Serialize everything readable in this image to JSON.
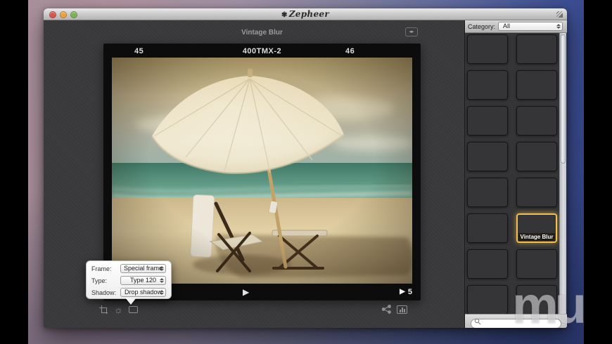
{
  "window": {
    "title": "Zepheer",
    "logo_glyph": "✾",
    "traffic_lights": {
      "close": "#d9544c",
      "minimize": "#e8a33d",
      "zoom": "#7ab356"
    }
  },
  "canvas": {
    "filter_title": "Vintage Blur",
    "expand_glyph": "◂▸",
    "film": {
      "left_number": "45",
      "center_label": "400TMX-2",
      "right_number": "46",
      "play_glyph": "▶",
      "counter_play_glyph": "▶",
      "counter": "5"
    },
    "toolbar": {
      "sun_glyph": "☼"
    }
  },
  "popover": {
    "rows": [
      {
        "label": "Frame:",
        "value": "Special frame"
      },
      {
        "label": "Type:",
        "value": "Type 120"
      },
      {
        "label": "Shadow:",
        "value": "Drop shadow"
      }
    ]
  },
  "sidebar": {
    "category": {
      "label": "Category:",
      "value": "All"
    },
    "selected_thumb_label": "Vintage Blur",
    "accent_gold": "#f0be52",
    "thumbs": [
      {
        "style": "background-image:radial-gradient(ellipse 44% 30% at 47% 24%, #f8f4ed 0 58%, rgba(0,0,0,0) 63%),radial-gradient(ellipse 32% 17% at 49% 73%, rgba(128,44,36,.92) 0 55%, rgba(0,0,0,0) 63%),linear-gradient(180deg,#eedad6 0%,#e6cdd2 36%,#b4c0da 42%,#a9b6d2 54%,#e8d5cb 60%,#e0c5ba 100%);"
      },
      {
        "style": "background-image:radial-gradient(ellipse 44% 30% at 47% 24%, #f4f9f3 0 58%, rgba(0,0,0,0) 63%),radial-gradient(ellipse 32% 17% at 49% 73%, rgba(18,74,62,.95) 0 55%, rgba(0,0,0,0) 63%),linear-gradient(180deg,#8cc8de 0%,#54aac8 36%,#2f9488 44%,#3aa896 56%,#a6c8ae 64%,#8cb898 100%);box-shadow:inset 5px 0 0 #e9dfbc, inset -5px 0 0 #e9dfbc, 0 1px 3px rgba(0,0,0,.5);"
      },
      {
        "style": "background-image:radial-gradient(ellipse 44% 30% at 47% 24%, #f0e8cf 0 58%, rgba(0,0,0,0) 63%),radial-gradient(ellipse 32% 17% at 49% 73%, rgba(74,52,26,.95) 0 55%, rgba(0,0,0,0) 63%),linear-gradient(180deg,#d8c9a2 0%,#cdbb90 36%,#b6a87e 44%,#b0a276 56%,#ccb88c 62%,#c2ad7e 100%);box-shadow:inset 6px 0 0 #7c5c32, inset -6px 0 0 #6e5028, 0 1px 3px rgba(0,0,0,.5);"
      },
      {
        "style": "background-image:radial-gradient(ellipse at 50% 48%, rgba(0,0,0,0) 38%, rgba(18,12,4,.78) 100%),radial-gradient(ellipse 44% 30% at 47% 24%, #ddd2b2 0 58%, rgba(0,0,0,0) 63%),radial-gradient(ellipse 32% 17% at 49% 73%, rgba(40,28,16,.95) 0 55%, rgba(0,0,0,0) 63%),linear-gradient(180deg,#a09274 0%,#958862 36%,#8a8060 44%,#837a56 56%,#8f8260 62%,#7e7048 100%);"
      },
      {
        "style": "background-image:radial-gradient(ellipse 40% 26% at 47% 28%, #f3ecd4 0 58%, rgba(0,0,0,0) 63%),radial-gradient(ellipse 30% 15% at 49% 70%, rgba(90,66,36,.8) 0 55%, rgba(0,0,0,0) 63%),linear-gradient(180deg,#e0d3ac 0%,#d8cba6 50%,#cfc096 100%);box-shadow:inset 0 0 0 5px #efe6c9, 0 1px 3px rgba(0,0,0,.5);"
      },
      {
        "style": "background-color:#160505;background-image:repeating-linear-gradient(112deg, rgba(225,45,55,.9) 0 1px, rgba(0,0,0,0) 1px 6px),repeating-linear-gradient(28deg, rgba(180,30,60,.55) 0 1px, rgba(0,0,0,0) 1px 8px),radial-gradient(ellipse at 55% 45%, rgba(120,10,20,.6) 0 45%, rgba(0,0,0,0) 62%);"
      },
      {
        "style": "background-color:#16160f;background-image:radial-gradient(ellipse 30% 16% at 49% 66%, rgba(60,58,38,.9) 0 55%, rgba(0,0,0,0) 63%),radial-gradient(ellipse 46% 42% at 50% 50%, #c2dcb2 0 48%, #8fae85 62%, #2a2a1e 92%);"
      },
      {
        "style": "background-color:#969696;background-repeat:no-repeat;background-image:radial-gradient(circle, #2e2e2e 0 40%, rgba(0,0,0,0) 46%),radial-gradient(circle, #2e2e2e 0 40%, rgba(0,0,0,0) 46%),linear-gradient(180deg,#e8f2f4 0 35%,#8ec4d0 35% 55%,#d8cba6 55% 100%),linear-gradient(#6b4a2e,#6b4a2e),linear-gradient(#8a8a8a,#7c7c7c);background-size:7px 7px,7px 7px,34px 24px,42px 32px,58px 42px;background-position:46px 4px,46px 13px,5px 6px,1px 2px,0 0;"
      },
      {
        "style": "background-image:radial-gradient(ellipse 44% 30% at 47% 24%, #fbfaf5 0 58%, rgba(0,0,0,0) 63%),radial-gradient(ellipse 32% 17% at 49% 73%, rgba(150,100,84,.55) 0 55%, rgba(0,0,0,0) 63%),linear-gradient(180deg,#eceae2 0%,#e4e3db 36%,#c2cecc 44%,#bcc8c4 56%,#ece2d2 62%,#e6dcca 100%);"
      },
      {
        "style": "background-image:radial-gradient(ellipse 40% 26% at 48% 20%, #e83020 0 60%, rgba(232,48,32,0) 66%),radial-gradient(ellipse 26% 16% at 48% 74%, #2038d8 0 58%, rgba(32,56,216,0) 66%),linear-gradient(180deg,#38d83a 0 14%,#8ae23a 26%,#e2e22e 36%,#3ad8c8 44%,#28a0e8 52%,#48c83a 62%,#b8e232 74%,#2848e0 88%,#2038c8 100%);"
      },
      {
        "style": "background-image:radial-gradient(ellipse 44% 30% at 47% 24%, #f7f3ea 0 58%, rgba(0,0,0,0) 63%),radial-gradient(ellipse 32% 17% at 49% 73%, rgba(130,84,66,.6) 0 55%, rgba(0,0,0,0) 63%),linear-gradient(180deg,#dfd8ce 0%,#d6d2ca 36%,#a6bab6 44%,#9cb2ae 56%,#e0d2bc 62%,#d8c8b0 100%);"
      },
      {
        "style": "background-image:radial-gradient(ellipse at 50% 50%, rgba(0,0,0,0) 40%, rgba(30,20,4,.5) 100%),radial-gradient(ellipse 44% 30% at 47% 24%, #eee3c4 0 58%, rgba(0,0,0,0) 63%),radial-gradient(ellipse 32% 17% at 49% 73%, rgba(52,36,18,.9) 0 55%, rgba(0,0,0,0) 63%),linear-gradient(180deg,#b6a57f 0%,#c2b28c 36%,#4e7e6c 44%,#5a8a76 56%,#c9a96f 62%,#ba9858 100%);"
      },
      {
        "style": "background-image:radial-gradient(ellipse 44% 30% at 47% 24%, #f7f5ee 0 58%, rgba(0,0,0,0) 63%),radial-gradient(ellipse 32% 17% at 49% 73%, rgba(80,54,32,.9) 0 55%, rgba(0,0,0,0) 63%),linear-gradient(180deg,#bcd8ea 0%,#a4cade 36%,#3a90a4 44%,#4aa0b0 56%,#e4d4ae 62%,#d8c89e 100%);"
      },
      {
        "style": "background-image:linear-gradient(180deg, rgba(255,255,255,0) 0 52%, rgba(40,90,130,.38) 70% 100%),repeating-radial-gradient(circle at 52% 42%, #e8eff3 0 3px, #8fb2c4 3px 6px, #c2d6de 6px 9px);"
      },
      {
        "style": "background-image:radial-gradient(ellipse 44% 30% at 47% 24%, #f6f5ef 0 58%, rgba(0,0,0,0) 63%),radial-gradient(ellipse 32% 17% at 49% 73%, rgba(70,48,30,.9) 0 55%, rgba(0,0,0,0) 63%),linear-gradient(180deg,#b2d4e8 0%,#98c6dc 36%,#2e88a0 44%,#3e98ac 56%,#dcd0a8 62%,#d0c298 100%);"
      },
      {
        "style": "background-image:radial-gradient(ellipse 48% 34% at 47% 26%, rgba(255,255,255,.85) 0 50%, rgba(255,255,255,0) 70%),radial-gradient(ellipse 34% 18% at 49% 72%, rgba(110,110,100,.5) 0 50%, rgba(0,0,0,0) 66%),linear-gradient(180deg,#d8e6ec 0 38%,#c2d2d8 44%,#b2c4cc 54%,#d8d2c0 62%,#cfc6b2 100%);"
      }
    ]
  },
  "search": {
    "value": ""
  },
  "watermark": {
    "text": "mu"
  }
}
